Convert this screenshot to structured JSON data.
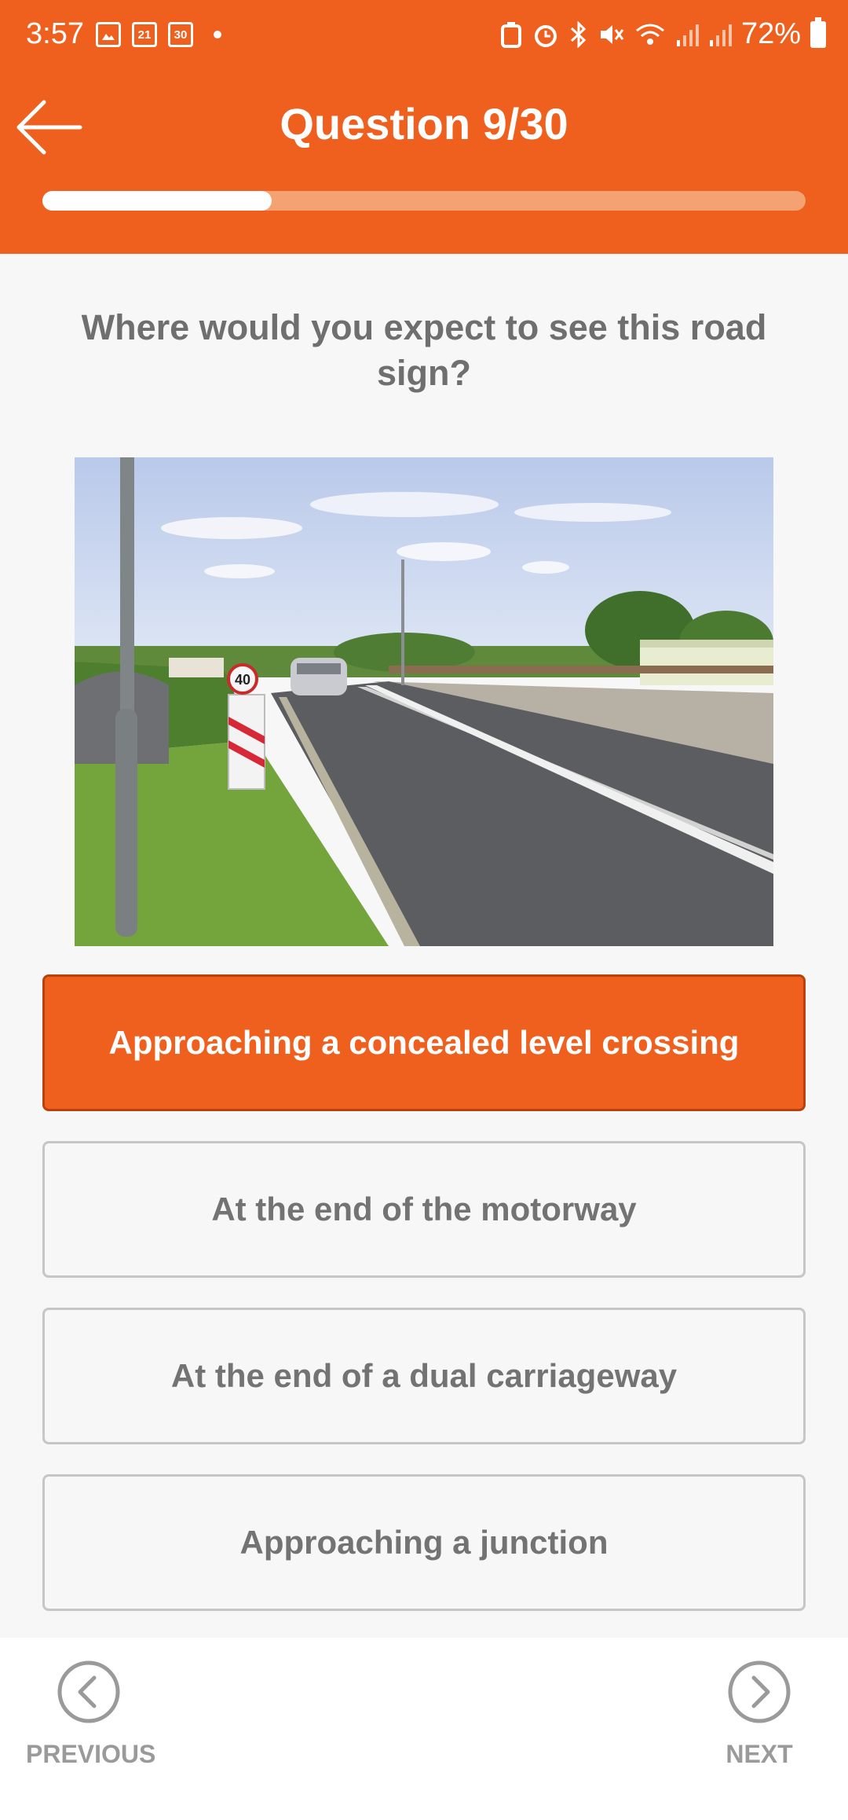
{
  "status_bar": {
    "time": "3:57",
    "calendar_day_1": "21",
    "calendar_day_2": "30",
    "battery_percent": "72%"
  },
  "header": {
    "title": "Question 9/30",
    "progress": 0.3
  },
  "question": {
    "text": "Where would you expect to see this road sign?"
  },
  "answers": [
    {
      "label": "Approaching a concealed level crossing",
      "selected": true
    },
    {
      "label": "At the end of the motorway",
      "selected": false
    },
    {
      "label": "At the end of a dual carriageway",
      "selected": false
    },
    {
      "label": "Approaching a junction",
      "selected": false
    }
  ],
  "navigation": {
    "previous_label": "PREVIOUS",
    "next_label": "NEXT"
  },
  "photo_sign_text": "40",
  "colors": {
    "accent": "#ef5f1e",
    "text_gray": "#737373"
  }
}
